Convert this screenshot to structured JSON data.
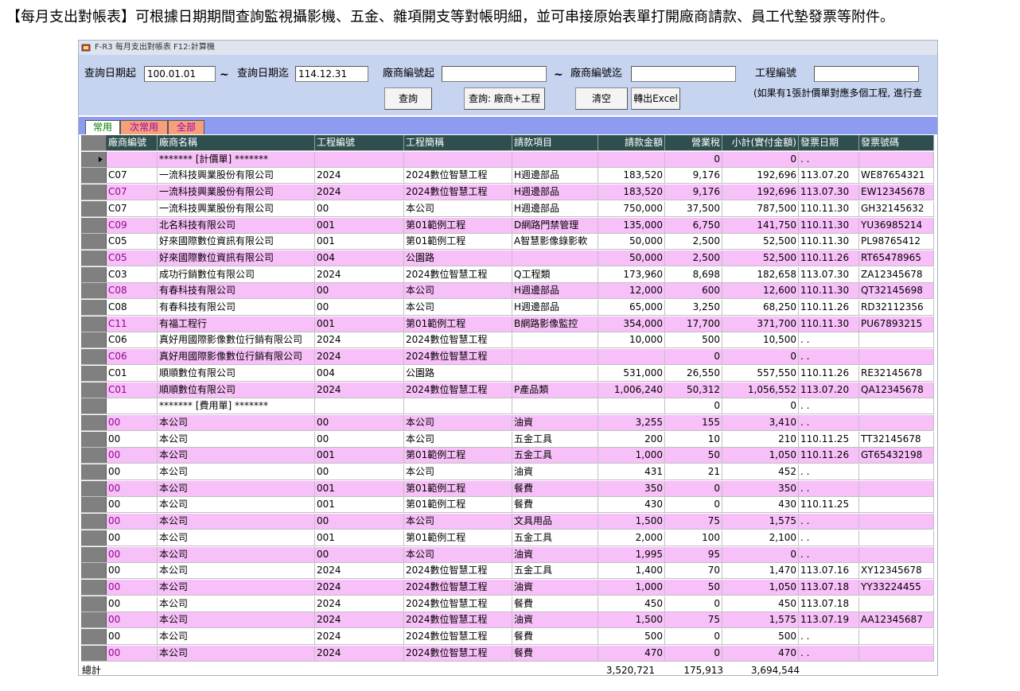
{
  "caption": "【每月支出對帳表】可根據日期期間查詢監視攝影機、五金、雜項開支等對帳明細，並可串接原始表單打開廠商請款、員工代墊發票等附件。",
  "window": {
    "title": "F-R3 每月支出對帳表   F12:計算機"
  },
  "filters": {
    "date_from_label": "查詢日期起",
    "date_from_value": "100.01.01",
    "tilde": "~",
    "date_to_label": "查詢日期迄",
    "date_to_value": "114.12.31",
    "vendor_from_label": "廠商編號起",
    "vendor_from_value": "",
    "vendor_to_label": "廠商編號迄",
    "vendor_to_value": "",
    "project_label": "工程編號",
    "project_value": "",
    "note": "(如果有1張計價單對應多個工程, 進行查"
  },
  "buttons": {
    "query": "查詢",
    "query_vendor_project": "查詢: 廠商+工程",
    "clear": "清空",
    "export_excel": "轉出Excel"
  },
  "tabs": [
    {
      "label": "常用",
      "active": true
    },
    {
      "label": "次常用",
      "active": false
    },
    {
      "label": "全部",
      "active": false
    }
  ],
  "columns": [
    "廠商編號",
    "廠商名稱",
    "工程編號",
    "工程簡稱",
    "請款項目",
    "請款金額",
    "營業稅",
    "小計(實付金額)",
    "發票日期",
    "發票號碼"
  ],
  "rows": [
    {
      "vendor_id": "",
      "vendor_name": "******* [計價單] *******",
      "project_id": "",
      "project_name": "",
      "item": "",
      "amount": "",
      "tax": "0",
      "subtotal": "0",
      "inv_date": ". .",
      "inv_no": "",
      "style": "pink",
      "current": true
    },
    {
      "vendor_id": "C07",
      "vendor_name": "一流科技興業股份有限公司",
      "project_id": "2024",
      "project_name": "2024數位智慧工程",
      "item": "H週邊部品",
      "amount": "183,520",
      "tax": "9,176",
      "subtotal": "192,696",
      "inv_date": "113.07.20",
      "inv_no": "WE87654321",
      "style": "white"
    },
    {
      "vendor_id": "C07",
      "vendor_name": "一流科技興業股份有限公司",
      "project_id": "2024",
      "project_name": "2024數位智慧工程",
      "item": "H週邊部品",
      "amount": "183,520",
      "tax": "9,176",
      "subtotal": "192,696",
      "inv_date": "113.07.30",
      "inv_no": "EW12345678",
      "style": "pink"
    },
    {
      "vendor_id": "C07",
      "vendor_name": "一流科技興業股份有限公司",
      "project_id": "00",
      "project_name": "本公司",
      "item": "H週邊部品",
      "amount": "750,000",
      "tax": "37,500",
      "subtotal": "787,500",
      "inv_date": "110.11.30",
      "inv_no": "GH32145632",
      "style": "white"
    },
    {
      "vendor_id": "C09",
      "vendor_name": "北名科技有限公司",
      "project_id": "001",
      "project_name": "第01範例工程",
      "item": "D網路門禁管理",
      "amount": "135,000",
      "tax": "6,750",
      "subtotal": "141,750",
      "inv_date": "110.11.30",
      "inv_no": "YU36985214",
      "style": "pink"
    },
    {
      "vendor_id": "C05",
      "vendor_name": "好來國際數位資訊有限公司",
      "project_id": "001",
      "project_name": "第01範例工程",
      "item": "A智慧影像錄影軟",
      "amount": "50,000",
      "tax": "2,500",
      "subtotal": "52,500",
      "inv_date": "110.11.30",
      "inv_no": "PL98765412",
      "style": "white"
    },
    {
      "vendor_id": "C05",
      "vendor_name": "好來國際數位資訊有限公司",
      "project_id": "004",
      "project_name": "公園路",
      "item": "",
      "amount": "50,000",
      "tax": "2,500",
      "subtotal": "52,500",
      "inv_date": "110.11.26",
      "inv_no": "RT65478965",
      "style": "pink"
    },
    {
      "vendor_id": "C03",
      "vendor_name": "成功行銷數位有限公司",
      "project_id": "2024",
      "project_name": "2024數位智慧工程",
      "item": "Q工程類",
      "amount": "173,960",
      "tax": "8,698",
      "subtotal": "182,658",
      "inv_date": "113.07.30",
      "inv_no": "ZA12345678",
      "style": "white"
    },
    {
      "vendor_id": "C08",
      "vendor_name": "有春科技有限公司",
      "project_id": "00",
      "project_name": "本公司",
      "item": "H週邊部品",
      "amount": "12,000",
      "tax": "600",
      "subtotal": "12,600",
      "inv_date": "110.11.30",
      "inv_no": "QT32145698",
      "style": "pink"
    },
    {
      "vendor_id": "C08",
      "vendor_name": "有春科技有限公司",
      "project_id": "00",
      "project_name": "本公司",
      "item": "H週邊部品",
      "amount": "65,000",
      "tax": "3,250",
      "subtotal": "68,250",
      "inv_date": "110.11.26",
      "inv_no": "RD32112356",
      "style": "white"
    },
    {
      "vendor_id": "C11",
      "vendor_name": "有福工程行",
      "project_id": "001",
      "project_name": "第01範例工程",
      "item": "B網路影像監控",
      "amount": "354,000",
      "tax": "17,700",
      "subtotal": "371,700",
      "inv_date": "110.11.30",
      "inv_no": "PU67893215",
      "style": "pink"
    },
    {
      "vendor_id": "C06",
      "vendor_name": "真好用國際影像數位行銷有限公司",
      "project_id": "2024",
      "project_name": "2024數位智慧工程",
      "item": "",
      "amount": "10,000",
      "tax": "500",
      "subtotal": "10,500",
      "inv_date": ". .",
      "inv_no": "",
      "style": "white"
    },
    {
      "vendor_id": "C06",
      "vendor_name": "真好用國際影像數位行銷有限公司",
      "project_id": "2024",
      "project_name": "2024數位智慧工程",
      "item": "",
      "amount": "",
      "tax": "0",
      "subtotal": "0",
      "inv_date": ". .",
      "inv_no": "",
      "style": "pink"
    },
    {
      "vendor_id": "C01",
      "vendor_name": "順順數位有限公司",
      "project_id": "004",
      "project_name": "公園路",
      "item": "",
      "amount": "531,000",
      "tax": "26,550",
      "subtotal": "557,550",
      "inv_date": "110.11.26",
      "inv_no": "RE32145678",
      "style": "white"
    },
    {
      "vendor_id": "C01",
      "vendor_name": "順順數位有限公司",
      "project_id": "2024",
      "project_name": "2024數位智慧工程",
      "item": "P產品類",
      "amount": "1,006,240",
      "tax": "50,312",
      "subtotal": "1,056,552",
      "inv_date": "113.07.20",
      "inv_no": "QA12345678",
      "style": "pink"
    },
    {
      "vendor_id": "",
      "vendor_name": "******* [費用單] *******",
      "project_id": "",
      "project_name": "",
      "item": "",
      "amount": "",
      "tax": "0",
      "subtotal": "0",
      "inv_date": ". .",
      "inv_no": "",
      "style": "white"
    },
    {
      "vendor_id": "00",
      "vendor_name": "本公司",
      "project_id": "00",
      "project_name": "本公司",
      "item": "油資",
      "amount": "3,255",
      "tax": "155",
      "subtotal": "3,410",
      "inv_date": ". .",
      "inv_no": "",
      "style": "pink"
    },
    {
      "vendor_id": "00",
      "vendor_name": "本公司",
      "project_id": "00",
      "project_name": "本公司",
      "item": "五金工具",
      "amount": "200",
      "tax": "10",
      "subtotal": "210",
      "inv_date": "110.11.25",
      "inv_no": "TT32145678",
      "style": "white"
    },
    {
      "vendor_id": "00",
      "vendor_name": "本公司",
      "project_id": "001",
      "project_name": "第01範例工程",
      "item": "五金工具",
      "amount": "1,000",
      "tax": "50",
      "subtotal": "1,050",
      "inv_date": "110.11.26",
      "inv_no": "GT65432198",
      "style": "pink"
    },
    {
      "vendor_id": "00",
      "vendor_name": "本公司",
      "project_id": "00",
      "project_name": "本公司",
      "item": "油資",
      "amount": "431",
      "tax": "21",
      "subtotal": "452",
      "inv_date": ". .",
      "inv_no": "",
      "style": "white"
    },
    {
      "vendor_id": "00",
      "vendor_name": "本公司",
      "project_id": "001",
      "project_name": "第01範例工程",
      "item": "餐費",
      "amount": "350",
      "tax": "0",
      "subtotal": "350",
      "inv_date": ". .",
      "inv_no": "",
      "style": "pink"
    },
    {
      "vendor_id": "00",
      "vendor_name": "本公司",
      "project_id": "001",
      "project_name": "第01範例工程",
      "item": "餐費",
      "amount": "430",
      "tax": "0",
      "subtotal": "430",
      "inv_date": "110.11.25",
      "inv_no": "",
      "style": "white"
    },
    {
      "vendor_id": "00",
      "vendor_name": "本公司",
      "project_id": "00",
      "project_name": "本公司",
      "item": "文具用品",
      "amount": "1,500",
      "tax": "75",
      "subtotal": "1,575",
      "inv_date": ". .",
      "inv_no": "",
      "style": "pink"
    },
    {
      "vendor_id": "00",
      "vendor_name": "本公司",
      "project_id": "001",
      "project_name": "第01範例工程",
      "item": "五金工具",
      "amount": "2,000",
      "tax": "100",
      "subtotal": "2,100",
      "inv_date": ". .",
      "inv_no": "",
      "style": "white"
    },
    {
      "vendor_id": "00",
      "vendor_name": "本公司",
      "project_id": "00",
      "project_name": "本公司",
      "item": "油資",
      "amount": "1,995",
      "tax": "95",
      "subtotal": "0",
      "inv_date": ". .",
      "inv_no": "",
      "style": "pink"
    },
    {
      "vendor_id": "00",
      "vendor_name": "本公司",
      "project_id": "2024",
      "project_name": "2024數位智慧工程",
      "item": "五金工具",
      "amount": "1,400",
      "tax": "70",
      "subtotal": "1,470",
      "inv_date": "113.07.16",
      "inv_no": "XY12345678",
      "style": "white"
    },
    {
      "vendor_id": "00",
      "vendor_name": "本公司",
      "project_id": "2024",
      "project_name": "2024數位智慧工程",
      "item": "油資",
      "amount": "1,000",
      "tax": "50",
      "subtotal": "1,050",
      "inv_date": "113.07.18",
      "inv_no": "YY33224455",
      "style": "pink"
    },
    {
      "vendor_id": "00",
      "vendor_name": "本公司",
      "project_id": "2024",
      "project_name": "2024數位智慧工程",
      "item": "餐費",
      "amount": "450",
      "tax": "0",
      "subtotal": "450",
      "inv_date": "113.07.18",
      "inv_no": "",
      "style": "white"
    },
    {
      "vendor_id": "00",
      "vendor_name": "本公司",
      "project_id": "2024",
      "project_name": "2024數位智慧工程",
      "item": "油資",
      "amount": "1,500",
      "tax": "75",
      "subtotal": "1,575",
      "inv_date": "113.07.19",
      "inv_no": "AA12345687",
      "style": "pink"
    },
    {
      "vendor_id": "00",
      "vendor_name": "本公司",
      "project_id": "2024",
      "project_name": "2024數位智慧工程",
      "item": "餐費",
      "amount": "500",
      "tax": "0",
      "subtotal": "500",
      "inv_date": ". .",
      "inv_no": "",
      "style": "white"
    },
    {
      "vendor_id": "00",
      "vendor_name": "本公司",
      "project_id": "2024",
      "project_name": "2024數位智慧工程",
      "item": "餐費",
      "amount": "470",
      "tax": "0",
      "subtotal": "470",
      "inv_date": ". .",
      "inv_no": "",
      "style": "pink"
    }
  ],
  "totals": {
    "label": "總計",
    "amount": "3,520,721",
    "tax": "175,913",
    "subtotal": "3,694,544"
  },
  "colors": {
    "toolbar_bg": "#c6d4f0",
    "tabstrip_bg": "#8e9cf0",
    "header_bg": "#2f4f4f",
    "row_pink": "#f8c0f8",
    "pink_text": "#8b0a8b",
    "tab_active_bg": "#ffffff",
    "tab_active_text": "#008000",
    "tab_inactive_bg": "#f5a07a",
    "tab_inactive_text": "#9b00b0"
  }
}
